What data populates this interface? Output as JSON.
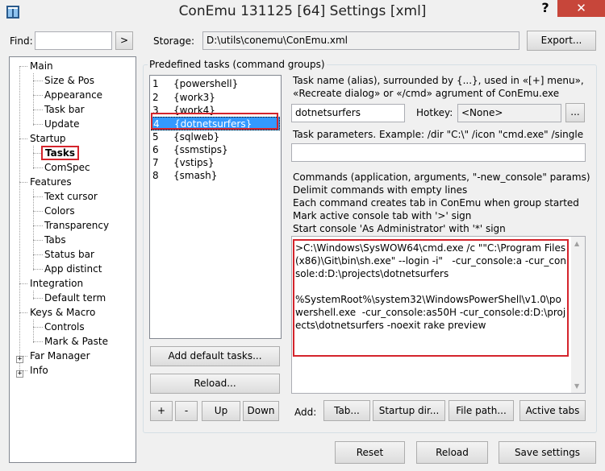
{
  "window": {
    "title": "ConEmu 131125 [64] Settings [xml]",
    "help": "?",
    "close": "✕"
  },
  "top": {
    "find_label": "Find:",
    "find_value": "",
    "find_btn": ">",
    "storage_label": "Storage:",
    "storage_value": "D:\\utils\\conemu\\ConEmu.xml",
    "export_btn": "Export..."
  },
  "tree": {
    "main": "Main",
    "size_pos": "Size & Pos",
    "appearance": "Appearance",
    "task_bar": "Task bar",
    "update": "Update",
    "startup": "Startup",
    "tasks": "Tasks",
    "comspec": "ComSpec",
    "features": "Features",
    "text_cursor": "Text cursor",
    "colors": "Colors",
    "transparency": "Transparency",
    "tabs": "Tabs",
    "status_bar": "Status bar",
    "app_distinct": "App distinct",
    "integration": "Integration",
    "default_term": "Default term",
    "keys_macro": "Keys & Macro",
    "controls": "Controls",
    "mark_paste": "Mark & Paste",
    "far_manager": "Far Manager",
    "info": "Info"
  },
  "tasks_group": {
    "title": "Predefined tasks (command groups)"
  },
  "tasks": [
    {
      "num": "1",
      "name": "{powershell}"
    },
    {
      "num": "2",
      "name": "{work3}"
    },
    {
      "num": "3",
      "name": "{work4}"
    },
    {
      "num": "4",
      "name": "{dotnetsurfers}"
    },
    {
      "num": "5",
      "name": "{sqlweb}"
    },
    {
      "num": "6",
      "name": "{ssmstips}"
    },
    {
      "num": "7",
      "name": "{vstips}"
    },
    {
      "num": "8",
      "name": "{smash}"
    }
  ],
  "task_buttons": {
    "add_default": "Add default tasks...",
    "reload": "Reload...",
    "plus": "+",
    "minus": "-",
    "up": "Up",
    "down": "Down"
  },
  "task_name": {
    "label1": "Task name (alias), surrounded by {...}, used in «[+] menu»,",
    "label2": "«Recreate dialog» or «/cmd» agrument of ConEmu.exe",
    "value": "dotnetsurfers",
    "hotkey_label": "Hotkey:",
    "hotkey_value": "<None>",
    "hotkey_btn": "..."
  },
  "params": {
    "label": "Task parameters. Example: /dir \"C:\\\" /icon \"cmd.exe\" /single",
    "value": ""
  },
  "commands": {
    "line1": "Commands (application, arguments, \"-new_console\" params)",
    "line2": "Delimit commands with empty lines",
    "line3": "Each command creates tab in ConEmu when group started",
    "line4": "Mark active console tab with '>' sign",
    "line5": "Start console 'As Administrator' with '*' sign",
    "text": ">C:\\Windows\\SysWOW64\\cmd.exe /c \"\"C:\\Program Files (x86)\\Git\\bin\\sh.exe\" --login -i\"   -cur_console:a -cur_console:d:D:\\projects\\dotnetsurfers\n\n%SystemRoot%\\system32\\WindowsPowerShell\\v1.0\\powershell.exe  -cur_console:as50H -cur_console:d:D:\\projects\\dotnetsurfers -noexit rake preview"
  },
  "add_row": {
    "label": "Add:",
    "tab": "Tab...",
    "startup_dir": "Startup dir...",
    "file_path": "File path...",
    "active_tabs": "Active tabs"
  },
  "bottom": {
    "reset": "Reset",
    "reload": "Reload",
    "save": "Save settings"
  }
}
